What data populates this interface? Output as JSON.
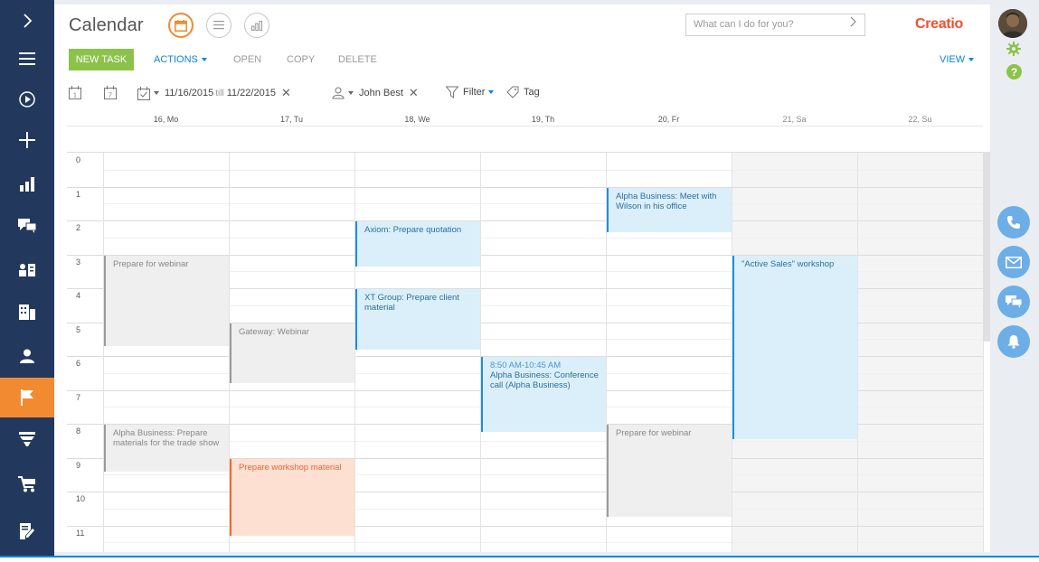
{
  "nav": {
    "items": [
      {
        "name": "nav-expand",
        "icon": "chevron-right-icon"
      },
      {
        "name": "nav-menu",
        "icon": "hamburger-icon"
      },
      {
        "name": "nav-run",
        "icon": "play-circle-icon"
      },
      {
        "name": "nav-add",
        "icon": "plus-icon"
      },
      {
        "name": "nav-dashboards",
        "icon": "bar-chart-icon"
      },
      {
        "name": "nav-feed",
        "icon": "chat-icon"
      },
      {
        "name": "nav-contacts",
        "icon": "contact-card-icon"
      },
      {
        "name": "nav-accounts",
        "icon": "building-icon"
      },
      {
        "name": "nav-users",
        "icon": "person-icon"
      },
      {
        "name": "nav-activities",
        "icon": "flag-icon"
      },
      {
        "name": "nav-funnel",
        "icon": "funnel-icon"
      },
      {
        "name": "nav-orders",
        "icon": "cart-icon"
      },
      {
        "name": "nav-documents",
        "icon": "document-edit-icon"
      }
    ]
  },
  "header": {
    "title": "Calendar",
    "search_placeholder": "What can I do for you?",
    "logo": "Creatio"
  },
  "toolbar": {
    "new_task": "NEW TASK",
    "actions": "ACTIONS",
    "open": "OPEN",
    "copy": "COPY",
    "delete": "DELETE",
    "view": "VIEW"
  },
  "filters": {
    "date_from": "11/16/2015",
    "till": "till",
    "date_to": "11/22/2015",
    "owner": "John Best",
    "filter": "Filter",
    "tag": "Tag"
  },
  "days": [
    {
      "label": "16, Mo",
      "weekend": false
    },
    {
      "label": "17, Tu",
      "weekend": false
    },
    {
      "label": "18, We",
      "weekend": false
    },
    {
      "label": "19, Th",
      "weekend": false
    },
    {
      "label": "20, Fr",
      "weekend": false
    },
    {
      "label": "21, Sa",
      "weekend": true
    },
    {
      "label": "22, Su",
      "weekend": true
    }
  ],
  "hours": [
    "0",
    "1",
    "2",
    "3",
    "4",
    "5",
    "6",
    "7",
    "8",
    "9",
    "10",
    "11"
  ],
  "events": [
    {
      "day": 0,
      "start": 3,
      "end": 5.7,
      "style": "gray",
      "title": "Prepare for webinar"
    },
    {
      "day": 0,
      "start": 8,
      "end": 9.4,
      "style": "gray",
      "title": "Alpha Business: Prepare materials for the trade show"
    },
    {
      "day": 1,
      "start": 5,
      "end": 6.8,
      "style": "gray",
      "title": "Gateway: Webinar"
    },
    {
      "day": 1,
      "start": 9,
      "end": 11.3,
      "style": "orange",
      "title": "Prepare workshop material"
    },
    {
      "day": 2,
      "start": 2,
      "end": 3.35,
      "style": "blue",
      "title": "Axiom: Prepare quotation"
    },
    {
      "day": 2,
      "start": 4,
      "end": 5.8,
      "style": "blue",
      "title": "XT Group: Prepare client material"
    },
    {
      "day": 3,
      "start": 6,
      "end": 8.25,
      "style": "blue",
      "time": "8:50 AM-10:45 AM",
      "title": "Alpha Business: Conference call (Alpha Business)"
    },
    {
      "day": 4,
      "start": 1,
      "end": 2.35,
      "style": "blue",
      "title": "Alpha Business: Meet with Wilson in his office"
    },
    {
      "day": 4,
      "start": 8,
      "end": 10.75,
      "style": "gray",
      "title": "Prepare for webinar"
    },
    {
      "day": 5,
      "start": 3,
      "end": 8.45,
      "style": "blue",
      "title": "\"Active Sales\" workshop"
    }
  ],
  "colors": {
    "nav_bg": "#22395d",
    "accent_orange": "#f28a31",
    "new_task_green": "#8bc34a",
    "link_blue": "#0a83e0",
    "logo_red": "#f0502e"
  },
  "rightbar": {
    "icons": [
      "avatar",
      "gear-icon",
      "help-icon",
      "phone-icon",
      "email-icon",
      "chat-icon",
      "bell-icon"
    ]
  }
}
